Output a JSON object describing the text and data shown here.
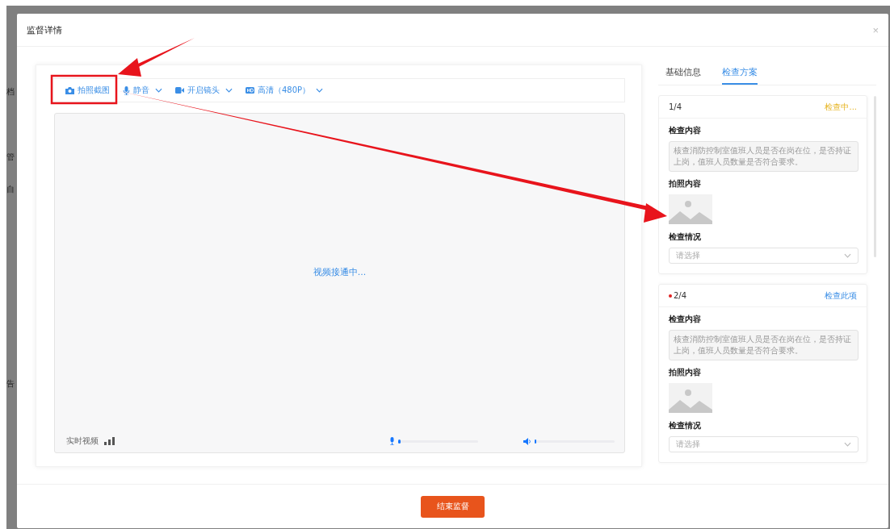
{
  "background_menu": [
    {
      "label": "档"
    },
    {
      "label": "管"
    },
    {
      "label": "自"
    },
    {
      "label": "告"
    }
  ],
  "dialog": {
    "title": "监督详情",
    "close": "×"
  },
  "toolbar": [
    {
      "kind": "camera",
      "label": "拍照截图",
      "dropdown": false
    },
    {
      "kind": "mic",
      "label": "静音",
      "dropdown": true
    },
    {
      "kind": "video",
      "label": "开启镜头",
      "dropdown": true
    },
    {
      "kind": "hd",
      "label": "高清（480P）",
      "dropdown": true
    }
  ],
  "video": {
    "status": "视频接通中...",
    "label": "实时视频",
    "mic": {
      "level": 0.03
    },
    "speaker": {
      "level": 0.01
    }
  },
  "tabs": [
    {
      "label": "基础信息",
      "selected": false
    },
    {
      "label": "检查方案",
      "selected": true
    }
  ],
  "checks": [
    {
      "index": "1/4",
      "flagged": false,
      "status": {
        "kind": "progress",
        "text": "检查中..."
      },
      "content_label": "检查内容",
      "content": "核查消防控制室值班人员是否在岗在位，是否持证上岗，值班人员数量是否符合要求。",
      "photo_label": "拍照内容",
      "result_label": "检查情况",
      "result_placeholder": "请选择"
    },
    {
      "index": "2/4",
      "flagged": true,
      "status": {
        "kind": "action",
        "text": "检查此项"
      },
      "content_label": "检查内容",
      "content": "核查消防控制室值班人员是否在岗在位，是否持证上岗，值班人员数量是否符合要求。",
      "photo_label": "拍照内容",
      "result_label": "检查情况",
      "result_placeholder": "请选择"
    }
  ],
  "footer": {
    "button": "结束监督"
  }
}
